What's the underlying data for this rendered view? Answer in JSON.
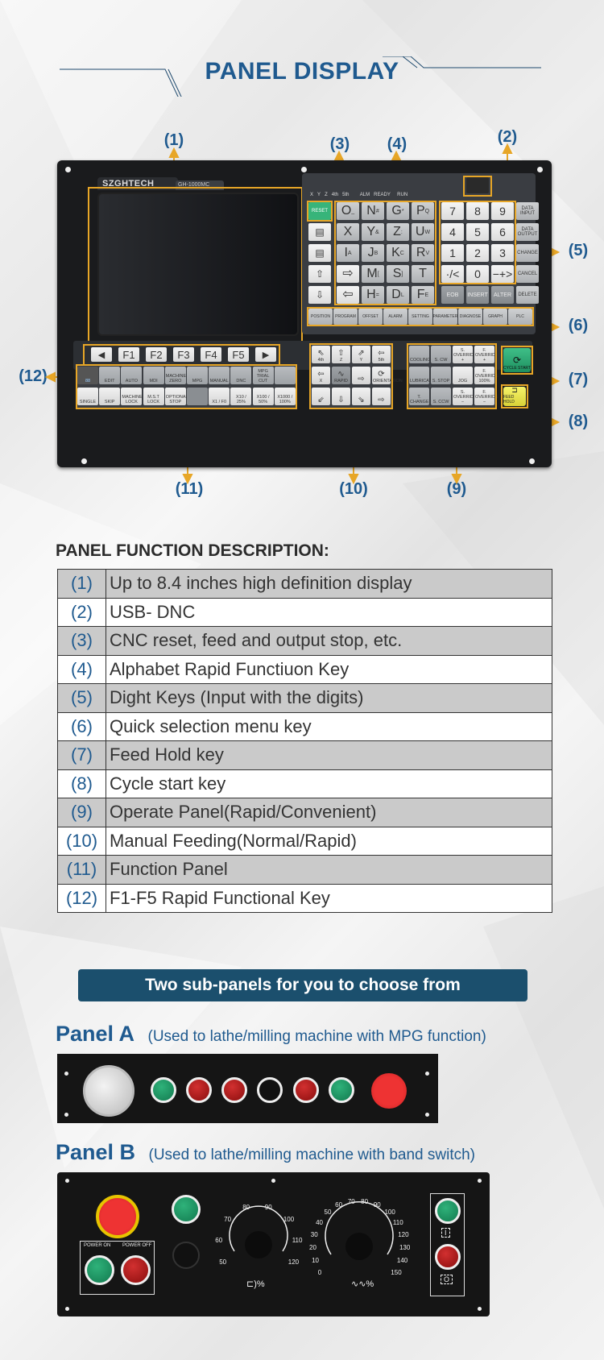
{
  "header": {
    "title": "PANEL DISPLAY"
  },
  "colors": {
    "accent_blue": "#1f5a8f",
    "callout_yellow": "#e7a627",
    "banner_bg": "#1b4f6d",
    "table_shade": "#cacaca"
  },
  "callouts": {
    "c1": "(1)",
    "c2": "(2)",
    "c3": "(3)",
    "c4": "(4)",
    "c5": "(5)",
    "c6": "(6)",
    "c7": "(7)",
    "c8": "(8)",
    "c9": "(9)",
    "c10": "(10)",
    "c11": "(11)",
    "c12": "(12)"
  },
  "panel": {
    "brand": "SZGHTECH",
    "model": "GH-1000MC",
    "status_axes": [
      "X",
      "Y",
      "Z",
      "4th",
      "5th"
    ],
    "status_lights": [
      "ALM",
      "READY",
      "RUN"
    ],
    "reset_label": "RESET",
    "alpha_keys": [
      [
        "O",
        "N",
        "G",
        "P"
      ],
      [
        "X",
        "Y",
        "Z",
        "U"
      ],
      [
        "I",
        "J",
        "K",
        "R"
      ],
      [
        "⇨",
        "M",
        "S",
        "T"
      ],
      [
        "⇦",
        "H",
        "D",
        "F"
      ]
    ],
    "alpha_sub": [
      [
        "_",
        "#",
        "*",
        "Q"
      ],
      [
        "",
        "&",
        ":",
        "W"
      ],
      [
        "A",
        "B",
        "C",
        "V"
      ],
      [
        "",
        "[",
        "]",
        ""
      ],
      [
        "",
        "=",
        "L",
        "E"
      ]
    ],
    "digit_keys": [
      [
        "7",
        "8",
        "9"
      ],
      [
        "4",
        "5",
        "6"
      ],
      [
        "1",
        "2",
        "3"
      ],
      [
        "·/<",
        "0",
        "−+>"
      ]
    ],
    "side_keys": [
      "DATA INPUT",
      "DATA OUTPUT",
      "CHANGE",
      "CANCEL",
      "DELETE"
    ],
    "edit_keys": [
      "EOB",
      "INSERT",
      "ALTER"
    ],
    "menu_keys": [
      "POSITION",
      "PROGRAM",
      "OFFSET",
      "ALARM",
      "SETTING",
      "PARAMETER",
      "DIAGNOSE",
      "GRAPH",
      "PLC"
    ],
    "fkeys": [
      "◀",
      "F1",
      "F2",
      "F3",
      "F4",
      "F5",
      "▶"
    ],
    "function_row1": [
      "88",
      "EDIT",
      "AUTO",
      "MDI",
      "MACHINE ZERO",
      "MPG",
      "MANUAL",
      "DNC",
      "MPG TRIAL CUT",
      ""
    ],
    "function_row2": [
      "SINGLE",
      "SKIP",
      "MACHINE LOCK",
      "M.S.T LOCK",
      "OPTIONAL STOP",
      "",
      "X1 / F0",
      "X10 / 25%",
      "X100 / 50%",
      "X1000 / 100%"
    ],
    "manual_keys": [
      "4th",
      "Z",
      "Y",
      "5th",
      "X",
      "RAPID",
      "",
      "ORIENTATION",
      "",
      "",
      "",
      ""
    ],
    "operate_keys": [
      "COOLING",
      "S. CW",
      "S. OVERRIDE +",
      "F. OVERRIDE +",
      "LUBRICATING",
      "S. STOP",
      "JOG",
      "F. OVERRIDE 100%",
      "T. CHANGE",
      "S. CCW",
      "S. OVERRIDE −",
      "F. OVERRIDE −"
    ],
    "cycle_start": "CYCLE START",
    "feed_hold": "FEED HOLD"
  },
  "description": {
    "title": "PANEL FUNCTION DESCRIPTION:",
    "rows": [
      {
        "num": "(1)",
        "text": "Up to 8.4 inches high definition display"
      },
      {
        "num": "(2)",
        "text": "USB- DNC"
      },
      {
        "num": "(3)",
        "text": "CNC reset, feed and output stop, etc."
      },
      {
        "num": "(4)",
        "text": "Alphabet Rapid Functiuon Key"
      },
      {
        "num": "(5)",
        "text": "Dight Keys (Input with the digits)"
      },
      {
        "num": "(6)",
        "text": "Quick selection menu key"
      },
      {
        "num": "(7)",
        "text": "Feed Hold key"
      },
      {
        "num": "(8)",
        "text": "Cycle start key"
      },
      {
        "num": "(9)",
        "text": "Operate Panel(Rapid/Convenient)"
      },
      {
        "num": "(10)",
        "text": "Manual Feeding(Normal/Rapid)"
      },
      {
        "num": "(11)",
        "text": "Function Panel"
      },
      {
        "num": "(12)",
        "text": "F1-F5 Rapid Functional Key"
      }
    ]
  },
  "subpanels": {
    "banner": "Two sub-panels for you to choose from",
    "panel_a": {
      "title": "Panel A",
      "subtitle": "(Used to lathe/milling machine with MPG function)"
    },
    "panel_b": {
      "title": "Panel B",
      "subtitle": "(Used to lathe/milling machine with band switch)",
      "power_on": "POWER ON",
      "power_off": "POWER OFF",
      "spindle_dial_ticks": [
        "50",
        "60",
        "70",
        "80",
        "90",
        "100",
        "110",
        "120"
      ],
      "feed_dial_ticks": [
        "0",
        "10",
        "20",
        "30",
        "40",
        "50",
        "60",
        "70",
        "80",
        "90",
        "100",
        "110",
        "120",
        "130",
        "140",
        "150"
      ],
      "spindle_label": "⊏)%",
      "feed_label": "∿∿%",
      "start_symbol": "I",
      "stop_symbol": "O"
    }
  }
}
